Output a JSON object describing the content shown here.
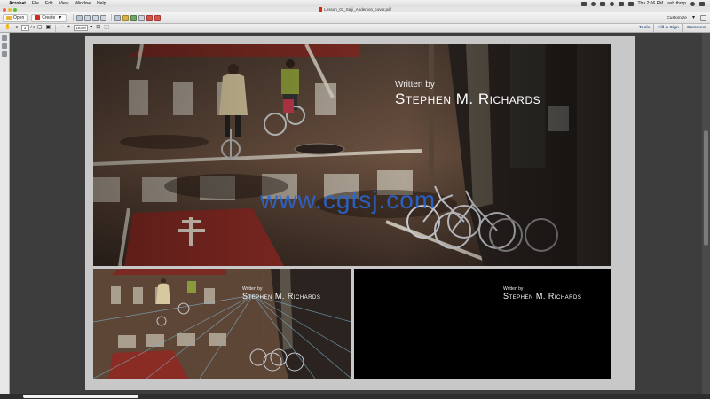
{
  "menubar": {
    "items": [
      "Acrobat",
      "File",
      "Edit",
      "View",
      "Window",
      "Help"
    ],
    "clock": "Thu 2:06 PM",
    "user": "ash thorp"
  },
  "window": {
    "title": "Lesson_03_Saiji_Anderson_cover.pdf"
  },
  "toolbar": {
    "open_label": "Open",
    "create_label": "Create",
    "customize_label": "Customize"
  },
  "pagenav": {
    "current_page": "3",
    "total_pages": "/ 3",
    "zoom": "163%"
  },
  "panels": {
    "tools": "Tools",
    "fill_sign": "Fill & Sign",
    "comment": "Comment"
  },
  "credit": {
    "written_by": "Written by",
    "name": "Stephen M. Richards"
  },
  "watermark": "www.cgtsj.com",
  "colors": {
    "accent": "#3b5c86",
    "watermark": "#2869dc"
  }
}
